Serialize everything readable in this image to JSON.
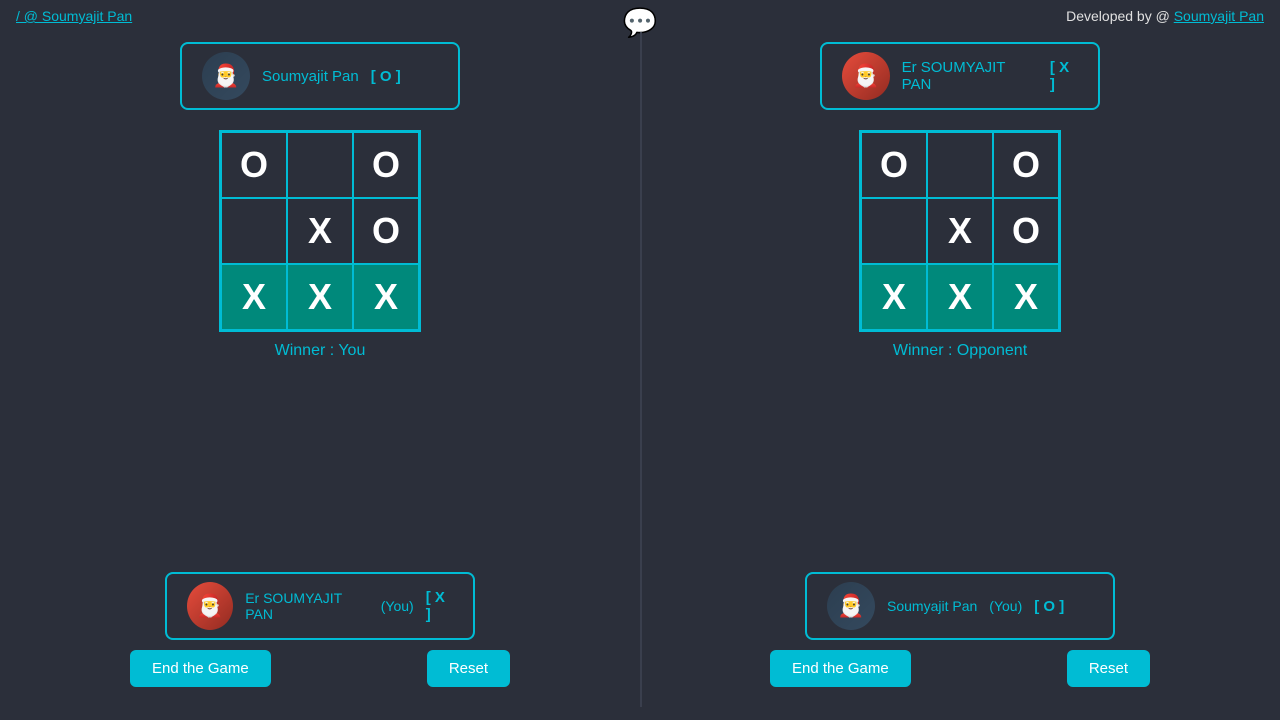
{
  "topbar": {
    "left_text": "/ @ Soumyajit Pan",
    "right_text": "Developed by @ Soumyajit Pan",
    "chat_icon": "💬"
  },
  "left_panel": {
    "top_player": {
      "name": "Soumyajit Pan",
      "symbol": "[ O ]",
      "avatar_emoji": "🎅"
    },
    "board": [
      [
        "O",
        "",
        "O"
      ],
      [
        "",
        "X",
        "O"
      ],
      [
        "X",
        "X",
        "X"
      ]
    ],
    "winning_row": 2,
    "winner_text": "Winner : You",
    "bottom_player": {
      "name": "Er SOUMYAJIT PAN",
      "suffix": "(You)",
      "symbol": "[ X ]",
      "avatar_emoji": "🎅"
    },
    "buttons": {
      "end": "End the Game",
      "reset": "Reset"
    }
  },
  "right_panel": {
    "top_player": {
      "name": "Er SOUMYAJIT PAN",
      "symbol": "[ X ]",
      "avatar_emoji": "🎅"
    },
    "board": [
      [
        "O",
        "",
        "O"
      ],
      [
        "",
        "X",
        "O"
      ],
      [
        "X",
        "X",
        "X"
      ]
    ],
    "winning_row": 2,
    "winner_text": "Winner : Opponent",
    "bottom_player": {
      "name": "Soumyajit Pan",
      "suffix": "(You)",
      "symbol": "[ O ]",
      "avatar_emoji": "🎅"
    },
    "buttons": {
      "end": "End the Game",
      "reset": "Reset"
    }
  }
}
